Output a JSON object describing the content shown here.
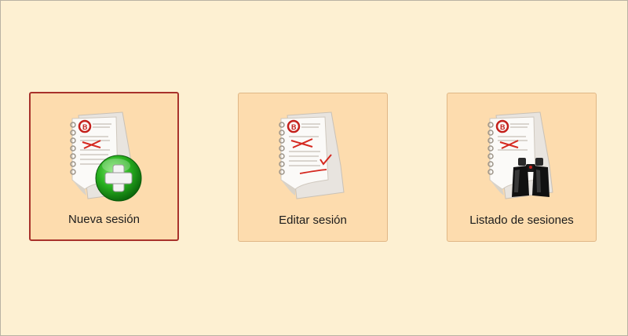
{
  "tiles": [
    {
      "label": "Nueva sesión",
      "overlay_icon": "add-plus-icon",
      "selected": true
    },
    {
      "label": "Editar sesión",
      "overlay_icon": "checkmark-icon",
      "selected": false
    },
    {
      "label": "Listado de sesiones",
      "overlay_icon": "binoculars-icon",
      "selected": false
    }
  ],
  "colors": {
    "background": "#fdf0d2",
    "tile": "#fddcae",
    "selected_border": "#a8322b",
    "accent_green": "#2db42d"
  }
}
